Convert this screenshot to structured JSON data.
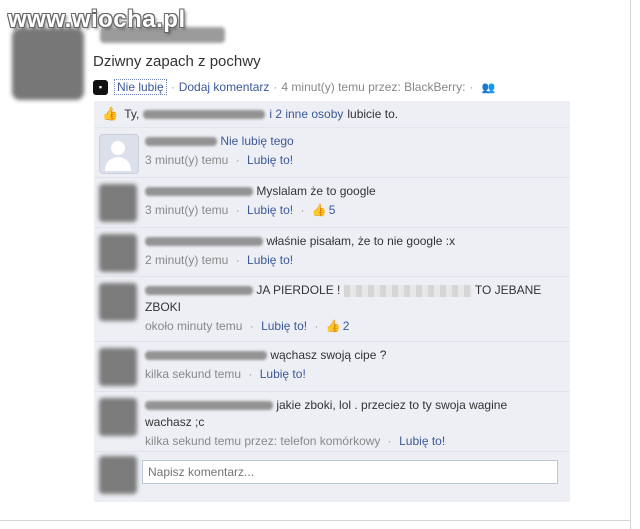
{
  "watermark": "www.wiocha.pl",
  "post": {
    "title": "Dziwny zapach z pochwy",
    "unlike_label": "Nie lubię",
    "add_comment_label": "Dodaj komentarz",
    "timestamp": "4 minut(y) temu przez: BlackBerry:",
    "separator": "·"
  },
  "likes": {
    "prefix": "Ty,",
    "others_link": "i 2 inne osoby",
    "suffix": "lubicie to."
  },
  "comments": [
    {
      "name_visible": "Nie lubię tego",
      "text": "",
      "time": "3 minut(y) temu",
      "like_label": "Lubię to!",
      "likes": "",
      "default_avatar": true
    },
    {
      "name_visible": "",
      "text": "Myslalam że to google",
      "time": "3 minut(y) temu",
      "like_label": "Lubię to!",
      "likes": "5"
    },
    {
      "name_visible": "",
      "text": "właśnie pisałam, że to nie google :x",
      "time": "2 minut(y) temu",
      "like_label": "Lubię to!",
      "likes": ""
    },
    {
      "name_visible": "",
      "text_a": "JA PIERDOLE !",
      "text_b": "TO JEBANE",
      "text_c": "ZBOKI",
      "time": "około minuty temu",
      "like_label": "Lubię to!",
      "likes": "2"
    },
    {
      "name_visible": "",
      "text": "wąchasz swoją cipe ?",
      "time": "kilka sekund temu",
      "like_label": "Lubię to!",
      "likes": ""
    },
    {
      "name_visible": "",
      "text_a": "jakie zboki, lol . przeciez to ty swoja wagine",
      "text_b": "wachasz ;c",
      "time": "kilka sekund temu przez: telefon komórkowy",
      "like_label": "Lubię to!",
      "likes": ""
    }
  ],
  "comment_input": {
    "placeholder": "Napisz komentarz..."
  },
  "icons": {
    "blackberry": "blackberry-icon",
    "like": "thumbs-up-icon",
    "people": "people-icon"
  },
  "colors": {
    "link": "#3b5998",
    "panel": "#edeff4",
    "meta": "#888888"
  }
}
